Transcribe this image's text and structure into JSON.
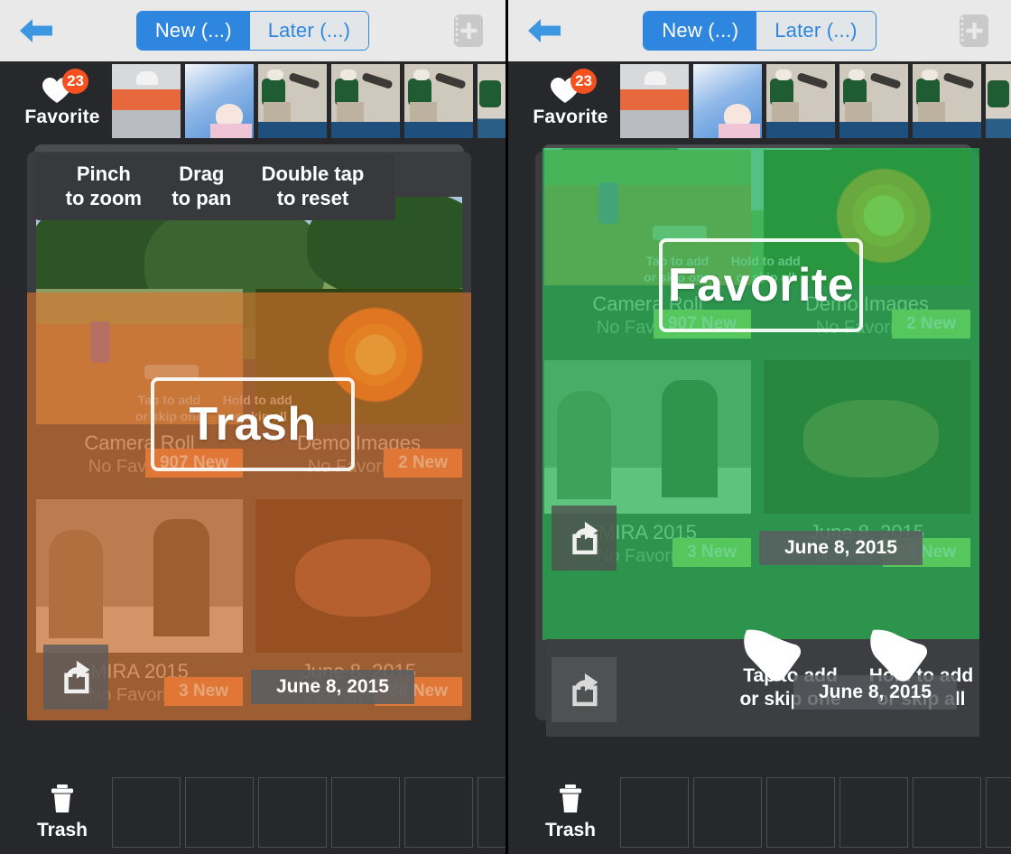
{
  "app": {
    "nav": {
      "back_icon": "back-arrow-icon",
      "add_icon": "add-album-icon",
      "segments": [
        {
          "label": "New (...)",
          "active": true
        },
        {
          "label": "Later (...)",
          "active": false
        }
      ]
    },
    "favorite_bar": {
      "icon": "heart-icon",
      "count": "23",
      "label": "Favorite"
    },
    "trash_bar": {
      "icon": "trash-icon",
      "label": "Trash"
    },
    "gesture_hints": [
      {
        "line1": "Pinch",
        "line2": "to zoom"
      },
      {
        "line1": "Drag",
        "line2": "to pan"
      },
      {
        "line1": "Double tap",
        "line2": "to reset"
      }
    ],
    "action_hints": [
      {
        "line1": "Tap to add",
        "line2": "or skip one"
      },
      {
        "line1": "Hold to add",
        "line2": "or skip all"
      }
    ],
    "albums": [
      {
        "title": "Camera Roll",
        "subtitle": "No Favorites",
        "badge": "907 New"
      },
      {
        "title": "Demo Images",
        "subtitle": "No Favorites",
        "badge": "2 New"
      },
      {
        "title": "MIRA 2015",
        "subtitle": "No Favorites",
        "badge": "3 New"
      },
      {
        "title": "June 8, 2015",
        "subtitle": "No Favorites",
        "badge": "38 New"
      }
    ],
    "date_chip": "June 8, 2015",
    "share_icon": "share-icon"
  },
  "panels": {
    "left": {
      "drop_target_label": "Trash",
      "tint_color": "#a8763f",
      "accent_color": "#e8653a"
    },
    "right": {
      "drop_target_label": "Favorite",
      "tint_color": "#31b65c",
      "accent_color": "#2aa84f"
    }
  },
  "colors": {
    "nav_background": "#e9e9e9",
    "segment_accent": "#2f86de",
    "app_background": "#26282c",
    "badge_orange": "#f4511e",
    "new_badge_left": "#f07f4a",
    "new_badge_right": "#b7d86a"
  }
}
